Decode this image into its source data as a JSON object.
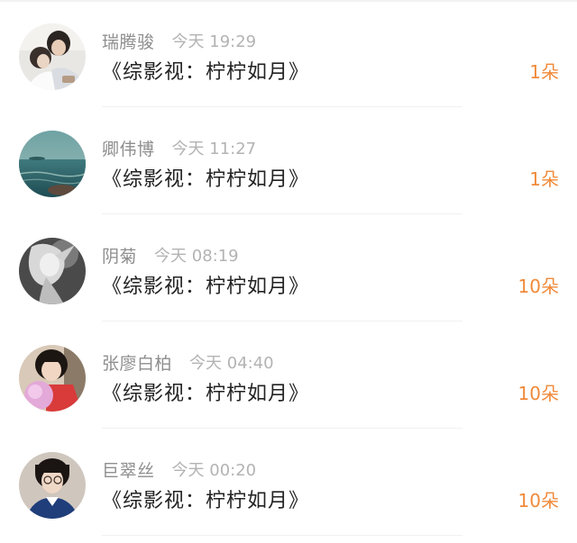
{
  "list": {
    "items": [
      {
        "name": "瑞腾骏",
        "time": "今天 19:29",
        "title": "《综影视：柠柠如月》",
        "count": "1朵"
      },
      {
        "name": "卿伟博",
        "time": "今天 11:27",
        "title": "《综影视：柠柠如月》",
        "count": "1朵"
      },
      {
        "name": "阴菊",
        "time": "今天 08:19",
        "title": "《综影视：柠柠如月》",
        "count": "10朵"
      },
      {
        "name": "张廖白柏",
        "time": "今天 04:40",
        "title": "《综影视：柠柠如月》",
        "count": "10朵"
      },
      {
        "name": "巨翠丝",
        "time": "今天 00:20",
        "title": "《综影视：柠柠如月》",
        "count": "10朵"
      }
    ]
  },
  "colors": {
    "accent": "#f08a3a",
    "name": "#8e8e8e",
    "time": "#b3b3b3",
    "title": "#222222"
  }
}
